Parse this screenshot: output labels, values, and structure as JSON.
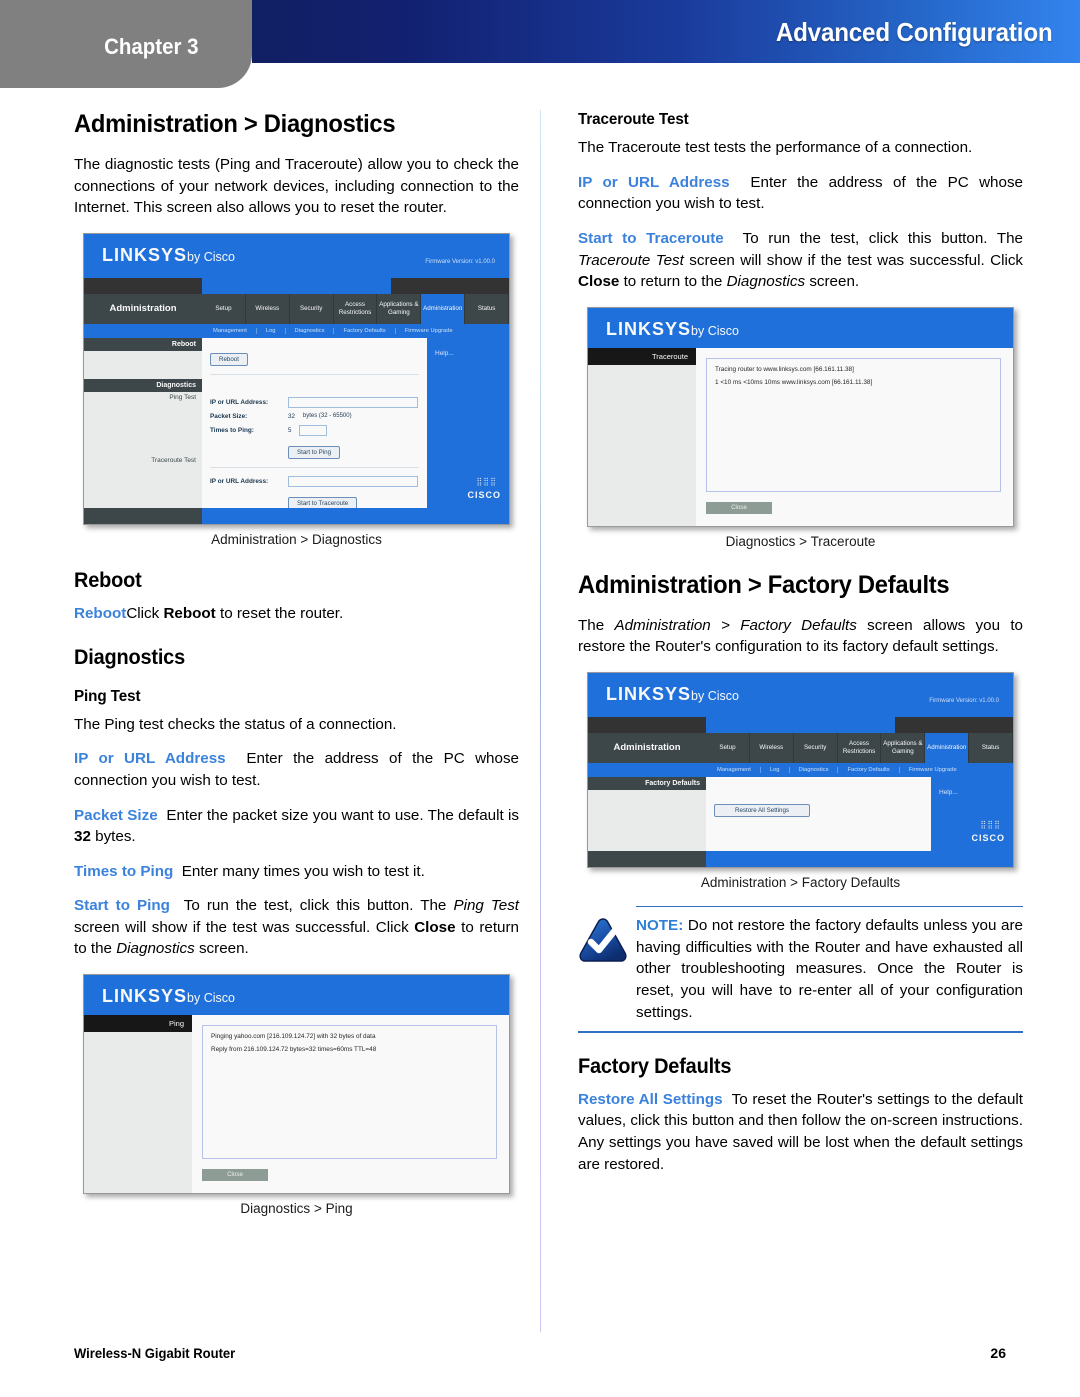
{
  "header": {
    "chapter": "Chapter 3",
    "title": "Advanced Configuration"
  },
  "left_column": {
    "section_title": "Administration > Diagnostics",
    "intro": "The diagnostic tests (Ping and Traceroute) allow you to check the connections of your network devices, including connection to the Internet. This screen also allows you to reset the router.",
    "figure1_caption": "Administration > Diagnostics",
    "reboot_heading": "Reboot",
    "reboot_term": "Reboot",
    "reboot_text_1": "Click ",
    "reboot_text_bold": "Reboot",
    "reboot_text_2": " to reset the router.",
    "diagnostics_heading": "Diagnostics",
    "ping_test_heading": "Ping Test",
    "ping_intro": "The Ping test checks the status of a connection.",
    "ip_url_term": "IP or URL Address",
    "ip_url_text": "Enter the address of the PC whose connection you wish to test.",
    "packet_size_term": "Packet Size",
    "packet_size_text_1": "Enter the packet size you want to use. The default is ",
    "packet_size_bold": "32",
    "packet_size_text_2": " bytes.",
    "times_to_ping_term": "Times to Ping",
    "times_to_ping_text": "Enter many times you wish to test it.",
    "start_ping_term": "Start to Ping",
    "start_ping_text_1": "To run the test, click this button. The ",
    "start_ping_italic_1": "Ping Test",
    "start_ping_text_2": " screen will show if the test was successful. Click ",
    "start_ping_bold": "Close",
    "start_ping_text_3": " to return to the ",
    "start_ping_italic_2": "Diagnostics",
    "start_ping_text_4": " screen.",
    "figure2_caption": "Diagnostics > Ping"
  },
  "right_column": {
    "traceroute_heading": "Traceroute Test",
    "traceroute_intro": "The Traceroute test tests the performance of a connection.",
    "ip_url_term": "IP or URL Address",
    "ip_url_text": "Enter the address of the PC whose connection you wish to test.",
    "start_trace_term": "Start to Traceroute",
    "start_trace_text_1": "To run the test, click this button. The ",
    "start_trace_italic_1": "Traceroute Test",
    "start_trace_text_2": " screen will show if the test was successful. Click ",
    "start_trace_bold": "Close",
    "start_trace_text_3": " to return to the ",
    "start_trace_italic_2": "Diagnostics",
    "start_trace_text_4": " screen.",
    "figure3_caption": "Diagnostics > Traceroute",
    "factory_title": "Administration > Factory Defaults",
    "factory_intro_1": "The ",
    "factory_intro_italic": "Administration > Factory Defaults",
    "factory_intro_2": " screen allows you to restore the Router's configuration to its factory default settings.",
    "figure4_caption": "Administration > Factory Defaults",
    "note_label": "NOTE:",
    "note_text": " Do not restore the factory defaults unless you are having difficulties with the Router and have exhausted all other troubleshooting measures. Once the Router is reset, you will have to re-enter all of your configuration settings.",
    "factory_defaults_heading": "Factory Defaults",
    "restore_term": "Restore All Settings",
    "restore_text": "To reset the Router's settings to the default values, click this button and then follow the on-screen instructions. Any settings you have saved will be lost when the default settings are restored."
  },
  "router_ui": {
    "brand": "LINKSYS",
    "brand_sub": "by Cisco",
    "firmware": "Firmware Version: v1.00.0",
    "module": "Administration",
    "tabs": [
      "Setup",
      "Wireless",
      "Security",
      "Access Restrictions",
      "Applications & Gaming",
      "Administration",
      "Status"
    ],
    "subtabs": [
      "Management",
      "Log",
      "Diagnostics",
      "Factory Defaults",
      "Firmware Upgrade"
    ],
    "diagnostics": {
      "side_reboot": "Reboot",
      "side_diagnostics": "Diagnostics",
      "side_ping_test": "Ping Test",
      "side_traceroute_test": "Traceroute Test",
      "reboot_button": "Reboot",
      "ip_url_label": "IP or URL Address:",
      "packet_size_label": "Packet Size:",
      "packet_size_value": "32",
      "packet_size_hint": "bytes (32 - 65500)",
      "times_to_ping_label": "Times to Ping:",
      "times_to_ping_value": "5",
      "start_ping_button": "Start to Ping",
      "trace_ip_label": "IP or URL Address:",
      "start_trace_button": "Start to Traceroute",
      "help_link": "Help...",
      "cisco": "CISCO"
    },
    "ping_popup": {
      "tab": "Ping",
      "line1": "Pinging yahoo.com [216.109.124.72] with 32 bytes of data",
      "line2": "Reply from 216.109.124.72 bytes=32 times=60ms TTL=48",
      "close_button": "Close"
    },
    "traceroute_popup": {
      "tab": "Traceroute",
      "line1": "Tracing router to www.linksys.com [66.161.11.38]",
      "line2": "1   <10 ms   <10ms   10ms   www.linksys.com [66.161.11.38]",
      "close_button": "Close"
    },
    "factory_popup": {
      "side_label": "Factory Defaults",
      "restore_button": "Restore All Settings",
      "help_link": "Help...",
      "cisco": "CISCO"
    }
  },
  "footer": {
    "product": "Wireless-N Gigabit Router",
    "page_number": "26"
  }
}
